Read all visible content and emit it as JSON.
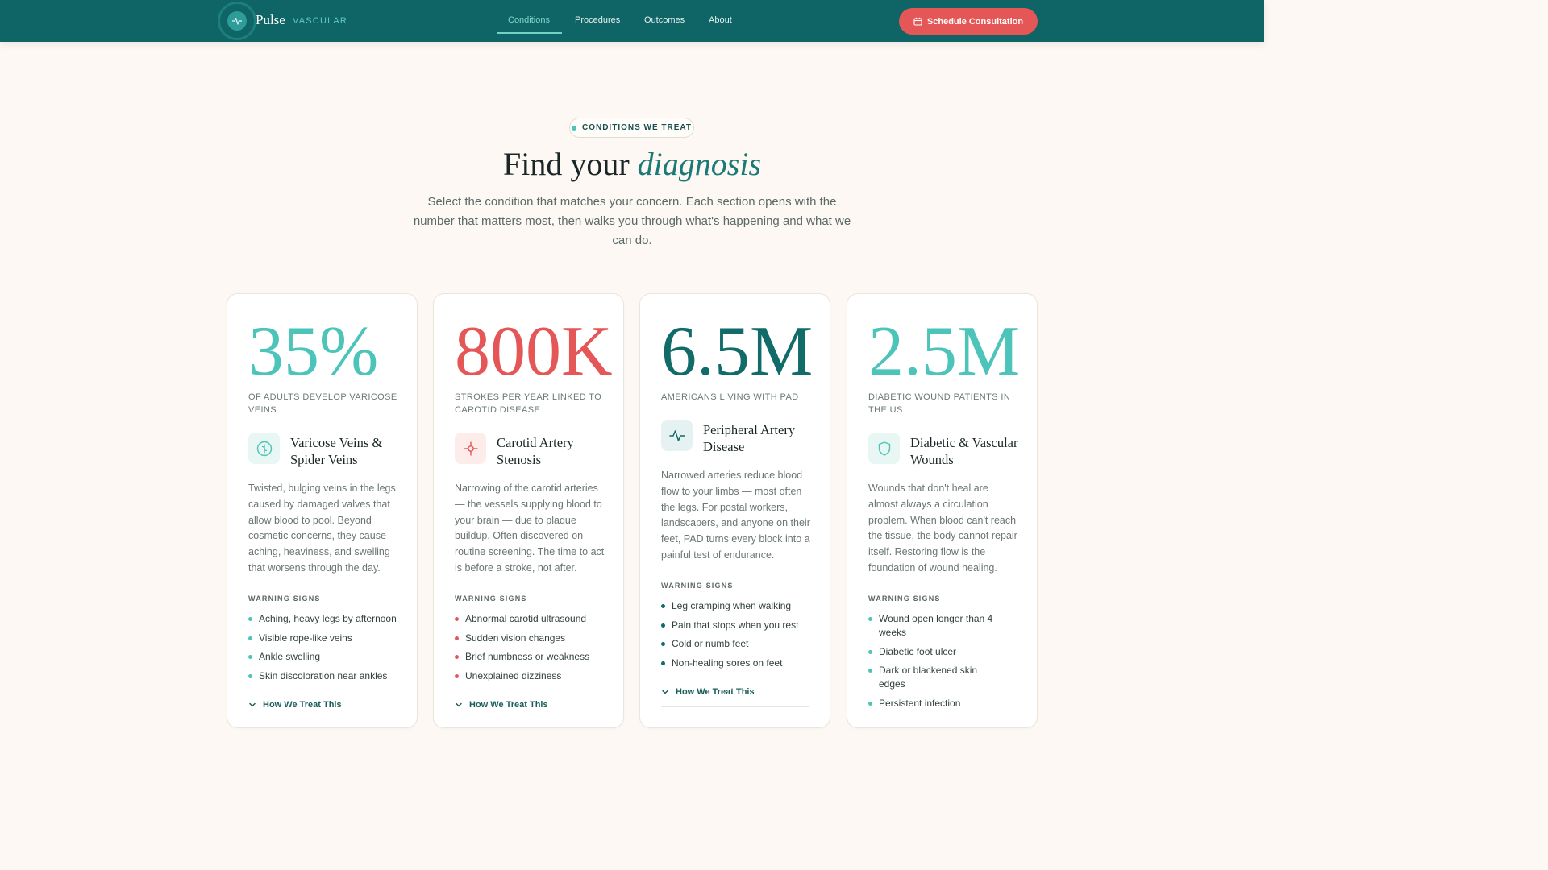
{
  "nav": {
    "brand": "Pulse",
    "brand_sub": "VASCULAR",
    "links": [
      "Conditions",
      "Procedures",
      "Outcomes",
      "About"
    ],
    "active_link": "Conditions",
    "cta_label": "Schedule Consultation"
  },
  "hero": {
    "eyebrow": "CONDITIONS WE TREAT",
    "title_plain": "Find your ",
    "title_em": "diagnosis",
    "subtitle": "Select the condition that matches your concern. Each section opens with the number that matters most, then walks you through what's happening and what we can do."
  },
  "colors": {
    "nav_bg": "#0f6466",
    "accent_teal": "#4cc4ba",
    "accent_red": "#e55656",
    "accent_dark_teal": "#106b69",
    "background": "#fdf8f3"
  },
  "cards": [
    {
      "stat": "35%",
      "stat_color": "#4cc4ba",
      "stat_label": "OF ADULTS DEVELOP VARICOSE VEINS",
      "icon": "droplet-icon",
      "title": "Varicose Veins & Spider Veins",
      "description": "Twisted, bulging veins in the legs caused by damaged valves that allow blood to pool. Beyond cosmetic concerns, they cause aching, heaviness, and swelling that worsens through the day.",
      "warning_heading": "WARNING SIGNS",
      "signs": [
        "Aching, heavy legs by afternoon",
        "Visible rope-like veins",
        "Ankle swelling",
        "Skin discoloration near ankles"
      ],
      "treat_label": "How We Treat This"
    },
    {
      "stat": "800K",
      "stat_color": "#e55656",
      "stat_label": "STROKES PER YEAR LINKED TO CAROTID DISEASE",
      "icon": "crosshair-icon",
      "title": "Carotid Artery Stenosis",
      "description": "Narrowing of the carotid arteries — the vessels supplying blood to your brain — due to plaque buildup. Often discovered on routine screening. The time to act is before a stroke, not after.",
      "warning_heading": "WARNING SIGNS",
      "signs": [
        "Abnormal carotid ultrasound",
        "Sudden vision changes",
        "Brief numbness or weakness",
        "Unexplained dizziness"
      ],
      "treat_label": "How We Treat This"
    },
    {
      "stat": "6.5M",
      "stat_color": "#106b69",
      "stat_label": "AMERICANS LIVING WITH PAD",
      "icon": "pulse-icon",
      "title": "Peripheral Artery Disease",
      "description": "Narrowed arteries reduce blood flow to your limbs — most often the legs. For postal workers, landscapers, and anyone on their feet, PAD turns every block into a painful test of endurance.",
      "warning_heading": "WARNING SIGNS",
      "signs": [
        "Leg cramping when walking",
        "Pain that stops when you rest",
        "Cold or numb feet",
        "Non-healing sores on feet"
      ],
      "treat_label": "How We Treat This"
    },
    {
      "stat": "2.5M",
      "stat_color": "#4cc4ba",
      "stat_label": "DIABETIC WOUND PATIENTS IN THE US",
      "icon": "shield-icon",
      "title": "Diabetic & Vascular Wounds",
      "description": "Wounds that don't heal are almost always a circulation problem. When blood can't reach the tissue, the body cannot repair itself. Restoring flow is the foundation of wound healing.",
      "warning_heading": "WARNING SIGNS",
      "signs": [
        "Wound open longer than 4 weeks",
        "Diabetic foot ulcer",
        "Dark or blackened skin edges",
        "Persistent infection"
      ],
      "treat_label": "How We Treat This"
    }
  ]
}
